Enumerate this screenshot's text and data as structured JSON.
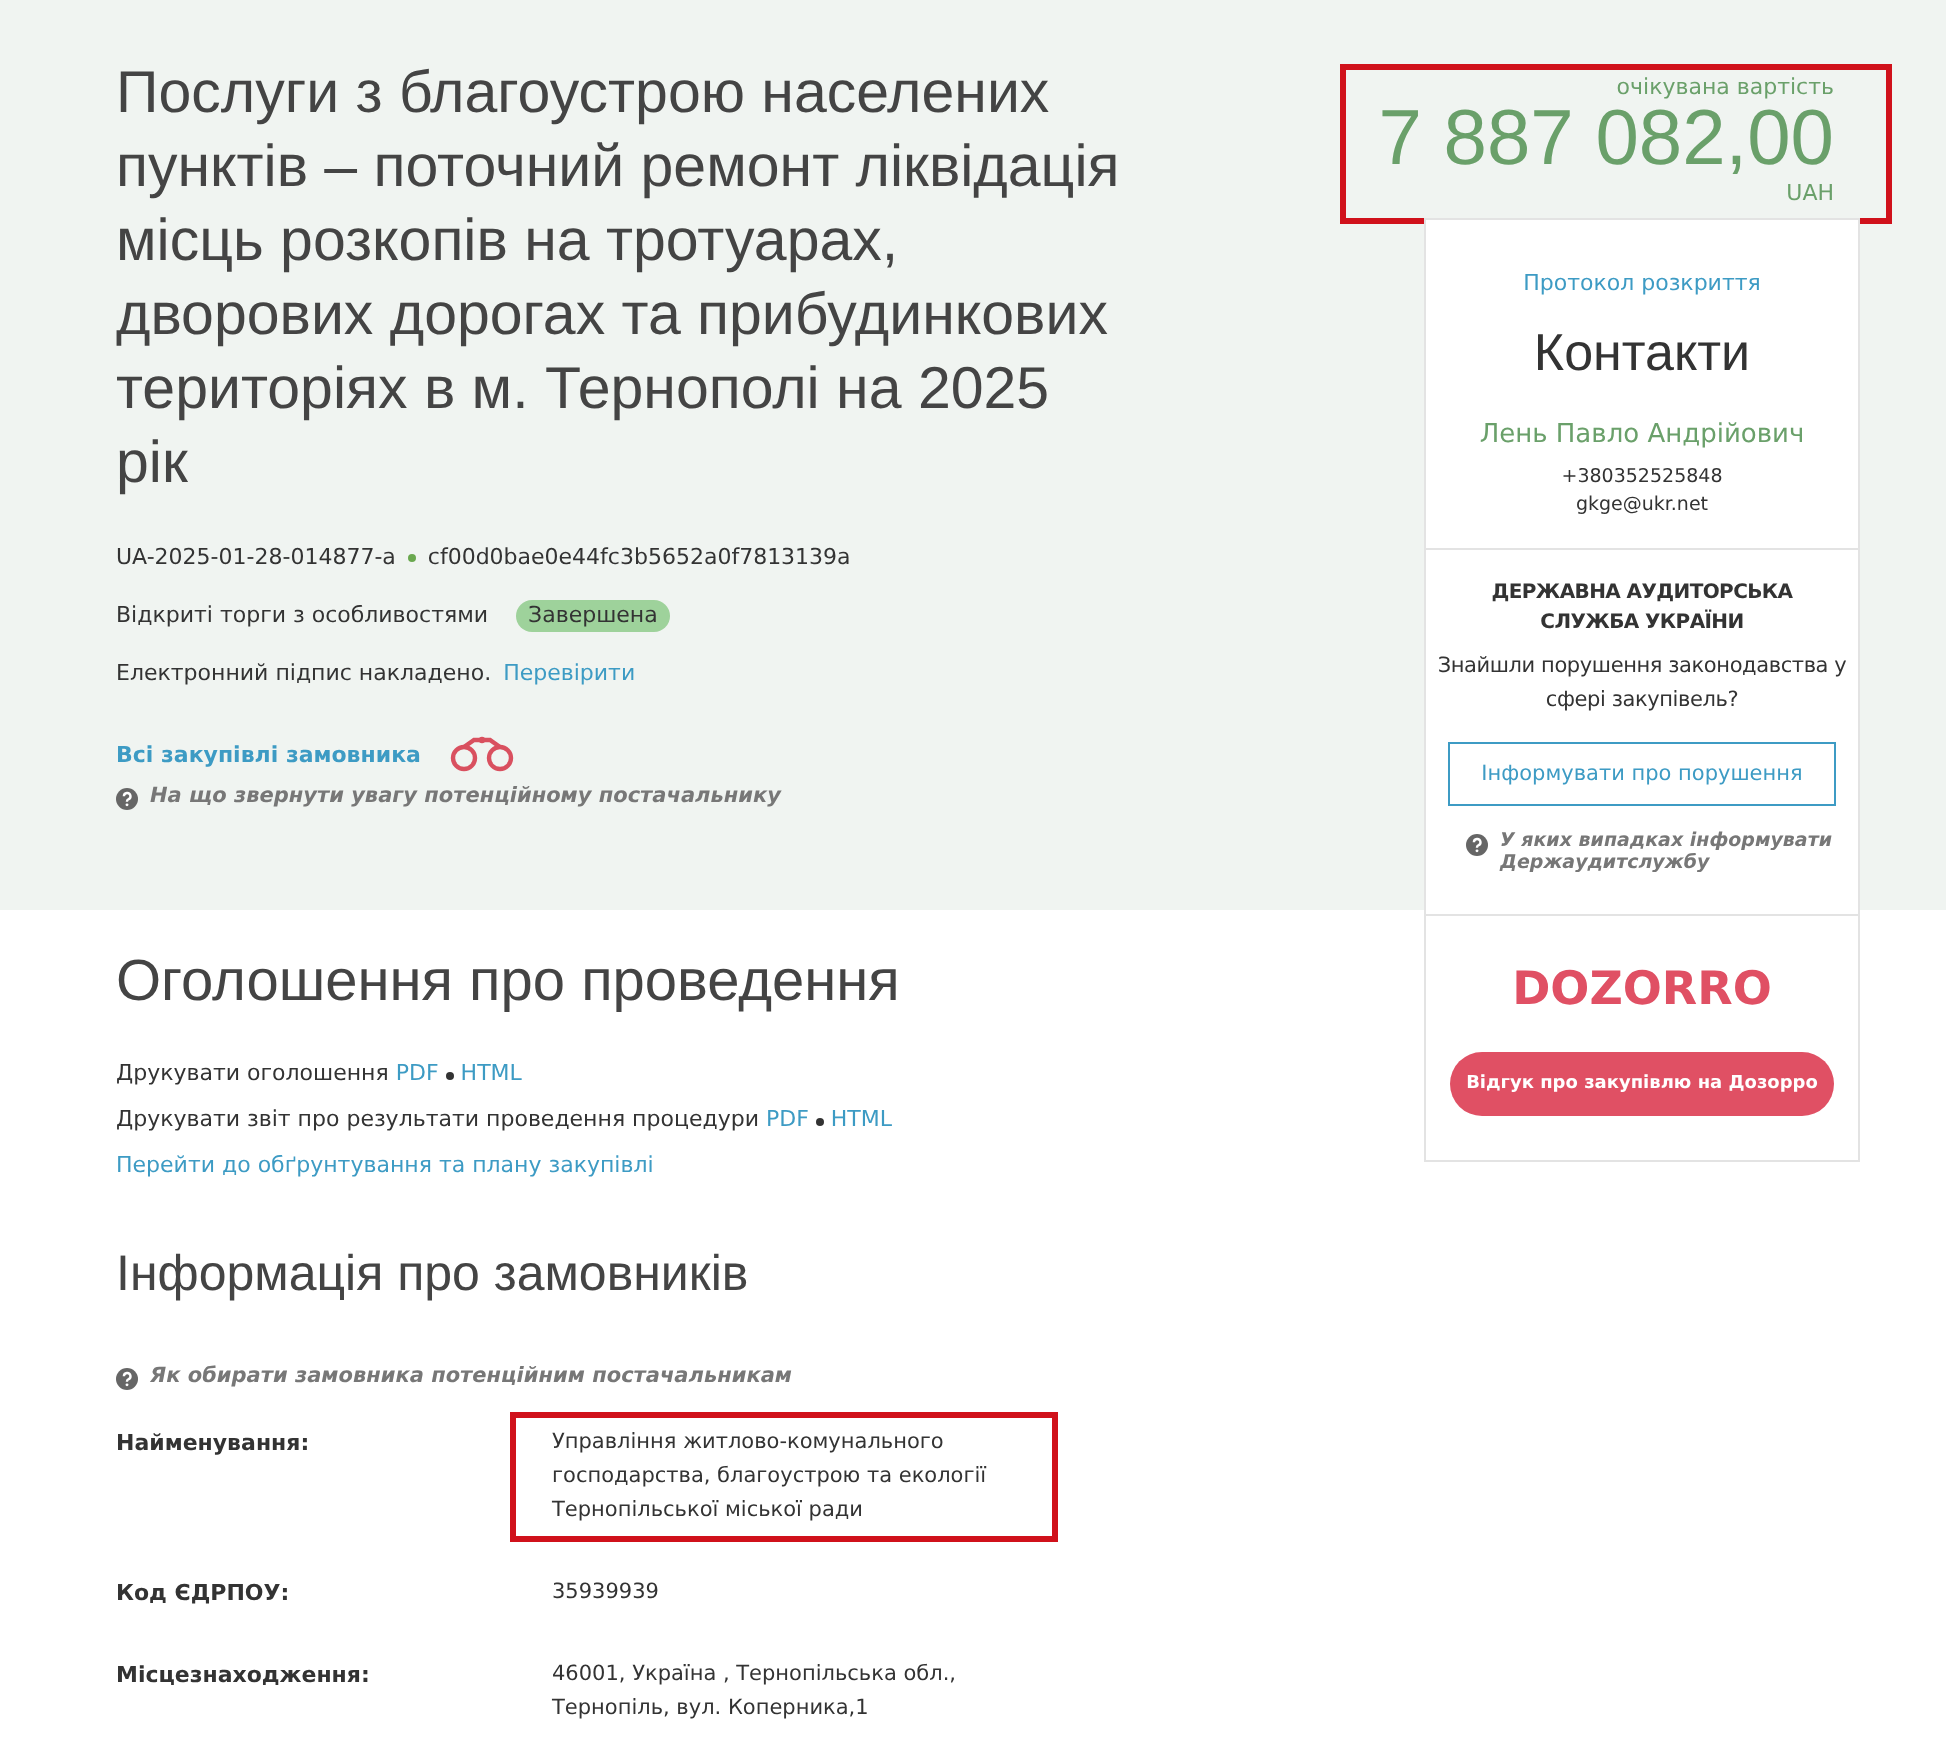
{
  "title": "Послуги з благоустрою населених пунктів – поточний ремонт ліквідація місць розкопів на тротуарах, дворових дорогах та прибудинкових територіях в м. Тернополі на 2025 рік",
  "tender_id": "UA-2025-01-28-014877-a",
  "hash": "cf00d0bae0e44fc3b5652a0f7813139a",
  "procedure": "Відкриті торги з особливостями",
  "status": "Завершена",
  "signature_text": "Електронний підпис накладено.",
  "signature_link": "Перевірити",
  "buyer_link": "Всі закупівлі замовника",
  "hint_supplier": "На що звернути увагу потенційному постачальнику",
  "price": {
    "label": "очікувана вартість",
    "amount": "7 887 082,00",
    "currency": "UAH",
    "highlighted": true
  },
  "contacts": {
    "protocol_link": "Протокол розкриття",
    "heading": "Контакти",
    "person": "Лень Павло Андрійович",
    "phone": "+380352525848",
    "email": "gkge@ukr.net"
  },
  "audit": {
    "heading": "ДЕРЖАВНА АУДИТОРСЬКА СЛУЖБА УКРАЇНИ",
    "question": "Знайшли порушення законодавства у сфері закупівель?",
    "button": "Інформувати про порушення",
    "hint": "У яких випадках інформувати Держаудитслужбу"
  },
  "dozorro": {
    "logo": "DOZORRO",
    "button": "Відгук про закупівлю на Дозорро"
  },
  "announcement": {
    "heading": "Оголошення про проведення",
    "print_rows": [
      {
        "text": "Друкувати оголошення",
        "links": [
          "PDF",
          "HTML"
        ]
      },
      {
        "text": "Друкувати звіт про результати проведення процедури",
        "links": [
          "PDF",
          "HTML"
        ]
      }
    ],
    "plan_link": "Перейти до обґрунтування та плану закупівлі"
  },
  "buyers": {
    "heading": "Інформація про замовників",
    "hint": "Як обирати замовника потенційним постачальникам",
    "fields": [
      {
        "label": "Найменування:",
        "value": "Управління житлово-комунального господарства, благоустрою та екології Тернопільської міської ради",
        "highlighted": true
      },
      {
        "label": "Код ЄДРПОУ:",
        "value": "35939939",
        "highlighted": false
      },
      {
        "label": "Місцезнаходження:",
        "value": "46001, Україна , Тернопільська обл., Тернопіль, вул. Коперника,1",
        "highlighted": false
      }
    ]
  }
}
